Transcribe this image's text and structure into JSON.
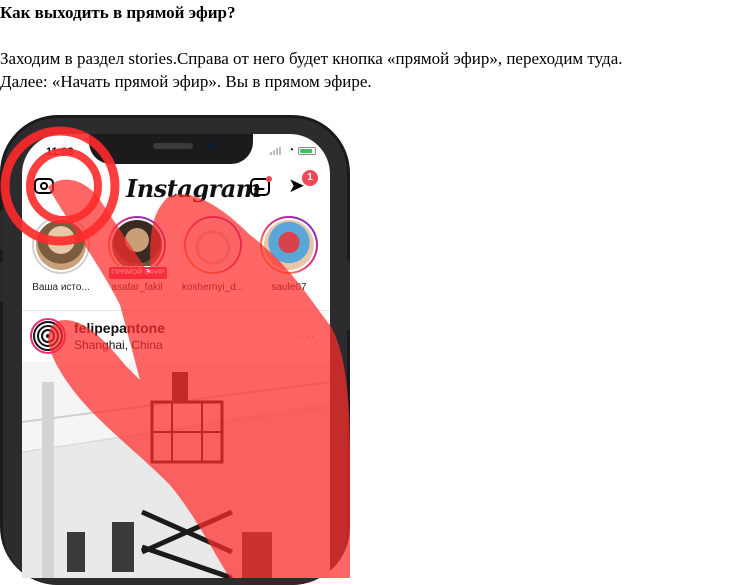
{
  "article": {
    "heading": "Как выходить в прямой эфир?",
    "paragraph_line1": "Заходим в раздел stories.Справа от него будет кнопка «прямой эфир», переходим туда.",
    "paragraph_line2": "Далее: «Начать прямой эфир». Вы в прямом эфире."
  },
  "phone": {
    "status": {
      "time": "11:08"
    },
    "app": {
      "logo": "Instagram",
      "dm_badge_count": "1",
      "icons": {
        "camera": "camera-icon",
        "igtv": "igtv-icon",
        "direct": "direct-message-icon"
      }
    },
    "stories": [
      {
        "name": "Ваша исто...",
        "live": false,
        "badge": ""
      },
      {
        "name": "asafar_fakil",
        "live": true,
        "badge": "ПРЯМОЙ ЭФИР"
      },
      {
        "name": "koshernyi_d...",
        "live": false,
        "badge": ""
      },
      {
        "name": "saule07",
        "live": false,
        "badge": ""
      }
    ],
    "post": {
      "username": "felipepantone",
      "location": "Shanghai, China",
      "more": "..."
    }
  },
  "colors": {
    "badge_red": "#ed4956",
    "live_pink": "#e1306c",
    "hand_overlay": "#ff2d2d"
  }
}
